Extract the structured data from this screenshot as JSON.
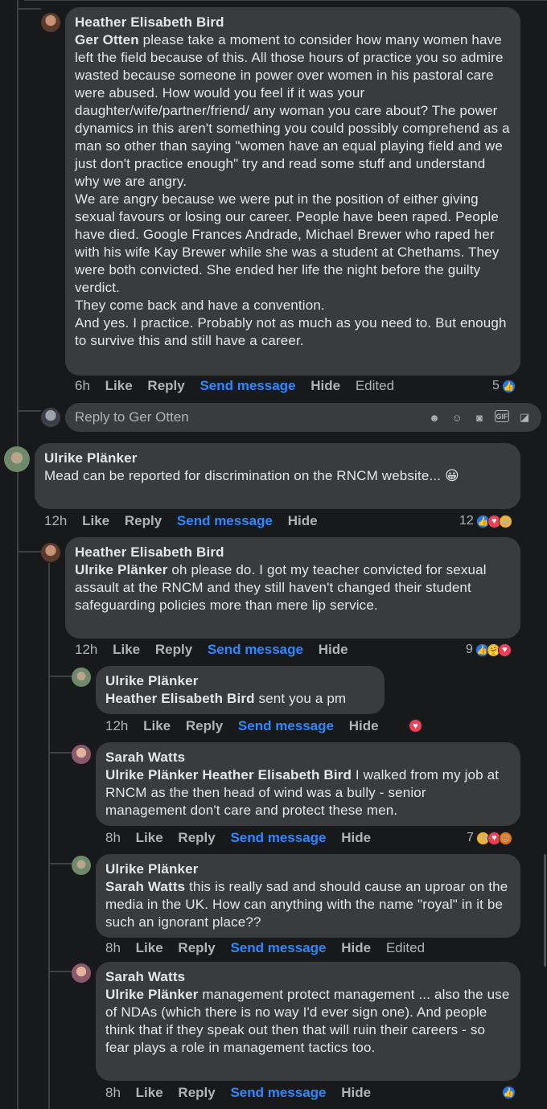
{
  "comments": [
    {
      "author": "Heather Elisabeth Bird",
      "tag": "Ger Otten",
      "text": " please take a moment to consider how many women have left the field because of this. All those hours of practice you so admire wasted because someone in power over women in his pastoral care were abused. How would you feel if it was your daughter/wife/partner/friend/ any woman you care about? The power dynamics in this aren't something you could possibly comprehend as a man so other than saying \"women have an equal playing field and we just don't practice enough\" try and read some stuff and understand why we are angry.\nWe are angry because we were put in the position of either giving sexual favours or losing our career. People have been raped. People have died. Google Frances Andrade, Michael Brewer who raped her with his wife Kay Brewer while she was a student at Chethams. They were both convicted. She ended her life the night before the guilty verdict.\nThey come back and have a convention.\nAnd yes. I practice. Probably not as much as you need to. But enough to survive this and still have a career.",
      "time": "6h",
      "like": "Like",
      "reply": "Reply",
      "send": "Send message",
      "hide": "Hide",
      "edited": "Edited",
      "reaction_count": "5"
    },
    {
      "author": "Ulrike Plänker",
      "tag": "",
      "text": "Mead can be reported for discrimination on the RNCM website... 😀",
      "time": "12h",
      "like": "Like",
      "reply": "Reply",
      "send": "Send message",
      "hide": "Hide",
      "reaction_count": "12"
    },
    {
      "author": "Heather Elisabeth Bird",
      "tag": "Ulrike Plänker",
      "text": " oh please do. I got my teacher convicted for sexual assault at the RNCM and they still haven't changed their student safeguarding policies more than mere lip service.",
      "time": "12h",
      "like": "Like",
      "reply": "Reply",
      "send": "Send message",
      "hide": "Hide",
      "reaction_count": "9"
    },
    {
      "author": "Ulrike Plänker",
      "tag": "Heather Elisabeth Bird",
      "text": " sent you a pm",
      "time": "12h",
      "like": "Like",
      "reply": "Reply",
      "send": "Send message",
      "hide": "Hide",
      "reaction_count": ""
    },
    {
      "author": "Sarah Watts",
      "tag": "Ulrike Plänker Heather Elisabeth Bird",
      "text": " I walked from my job at RNCM as the then head of wind was a bully - senior management don't care and protect these men.",
      "time": "8h",
      "like": "Like",
      "reply": "Reply",
      "send": "Send message",
      "hide": "Hide",
      "reaction_count": "7"
    },
    {
      "author": "Ulrike Plänker",
      "tag": "Sarah Watts",
      "text": " this is really sad and should cause an uproar on the media in the UK. How can anything with the name \"royal\" in it be such an ignorant place??",
      "time": "8h",
      "like": "Like",
      "reply": "Reply",
      "send": "Send message",
      "hide": "Hide",
      "edited": "Edited",
      "reaction_count": ""
    },
    {
      "author": "Sarah Watts",
      "tag": "Ulrike Plänker",
      "text": " management protect management ... also the use of NDAs (which there is no way I'd ever sign one). And people think that if they speak out then that will ruin their careers - so fear plays a role in management tactics too.",
      "time": "8h",
      "like": "Like",
      "reply": "Reply",
      "send": "Send message",
      "hide": "Hide",
      "reaction_count": ""
    }
  ],
  "reply_box": {
    "placeholder": "Reply to Ger Otten"
  },
  "icons": [
    "like-reaction-icon",
    "love-reaction-icon",
    "haha-reaction-icon",
    "care-reaction-icon",
    "sad-reaction-icon",
    "angry-reaction-icon",
    "avatar-sticker-icon",
    "emoji-icon",
    "camera-icon",
    "gif-icon",
    "sticker-icon"
  ],
  "colors": {
    "link": "#2d88ff",
    "bubble": "#3a3b3c",
    "like": "#2078f4",
    "love": "#f33e58",
    "haha": "#f7b125",
    "angry": "#e9710f"
  }
}
